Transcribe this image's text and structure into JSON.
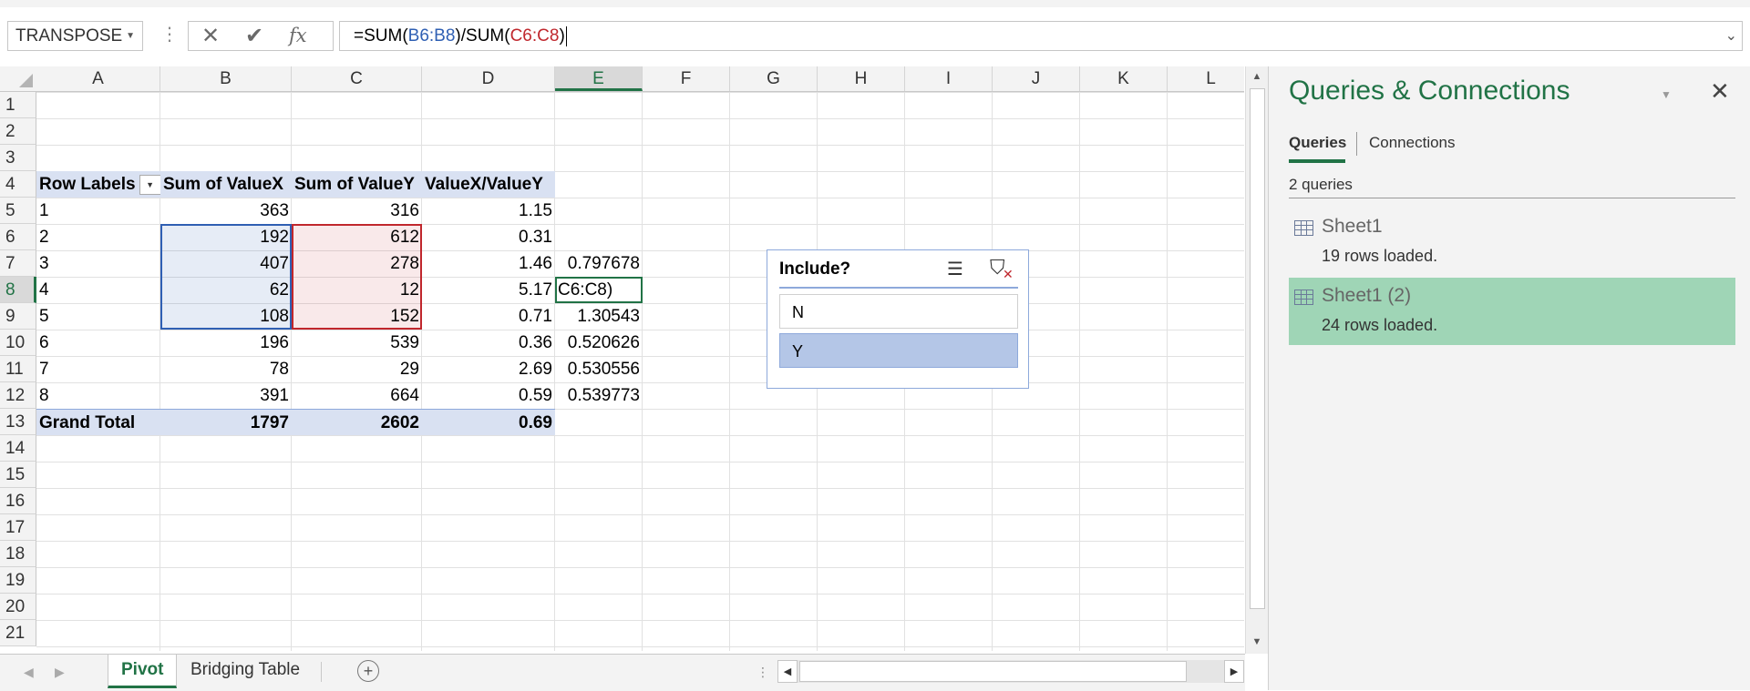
{
  "formula_bar": {
    "name_box": "TRANSPOSE",
    "formula_prefix": "=SUM(",
    "ref1": "B6:B8",
    "formula_mid": ")/SUM(",
    "ref2": "C6:C8",
    "formula_suffix": ")",
    "cancel_icon": "✕",
    "enter_icon": "✔",
    "fx_label": "fx"
  },
  "columns": [
    "A",
    "B",
    "C",
    "D",
    "E",
    "F",
    "G",
    "H",
    "I",
    "J",
    "K",
    "L"
  ],
  "active_column": "E",
  "rows": [
    "1",
    "2",
    "3",
    "4",
    "5",
    "6",
    "7",
    "8",
    "9",
    "10",
    "11",
    "12",
    "13",
    "14",
    "15",
    "16",
    "17",
    "18",
    "19",
    "20",
    "21"
  ],
  "active_row": "8",
  "pivot": {
    "headers": [
      "Row Labels",
      "Sum of ValueX",
      "Sum of ValueY",
      "ValueX/ValueY"
    ],
    "rows": [
      {
        "label": "1",
        "x": "363",
        "y": "316",
        "ratio": "1.15",
        "e": ""
      },
      {
        "label": "2",
        "x": "192",
        "y": "612",
        "ratio": "0.31",
        "e": ""
      },
      {
        "label": "3",
        "x": "407",
        "y": "278",
        "ratio": "1.46",
        "e": "0.797678"
      },
      {
        "label": "4",
        "x": "62",
        "y": "12",
        "ratio": "5.17",
        "e": "C6:C8)"
      },
      {
        "label": "5",
        "x": "108",
        "y": "152",
        "ratio": "0.71",
        "e": "1.30543"
      },
      {
        "label": "6",
        "x": "196",
        "y": "539",
        "ratio": "0.36",
        "e": "0.520626"
      },
      {
        "label": "7",
        "x": "78",
        "y": "29",
        "ratio": "2.69",
        "e": "0.530556"
      },
      {
        "label": "8",
        "x": "391",
        "y": "664",
        "ratio": "0.59",
        "e": "0.539773"
      }
    ],
    "grand_total": {
      "label": "Grand Total",
      "x": "1797",
      "y": "2602",
      "ratio": "0.69"
    }
  },
  "slicer": {
    "title": "Include?",
    "items": [
      {
        "label": "N",
        "selected": false
      },
      {
        "label": "Y",
        "selected": true
      }
    ]
  },
  "sheet_tabs": {
    "tabs": [
      {
        "label": "Pivot",
        "active": true
      },
      {
        "label": "Bridging Table",
        "active": false
      }
    ],
    "add_label": "+"
  },
  "pane": {
    "title": "Queries & Connections",
    "tabs": [
      "Queries",
      "Connections"
    ],
    "count": "2 queries",
    "queries": [
      {
        "name": "Sheet1",
        "status": "19 rows loaded.",
        "selected": false
      },
      {
        "name": "Sheet1 (2)",
        "status": "24 rows loaded.",
        "selected": true
      }
    ]
  },
  "colors": {
    "accent": "#217346",
    "ref1": "#2f5fb3",
    "ref2": "#c0272d",
    "pivot_header": "#d9e1f2",
    "slicer_selected": "#b4c6e7",
    "query_selected": "#9fd5b6"
  }
}
